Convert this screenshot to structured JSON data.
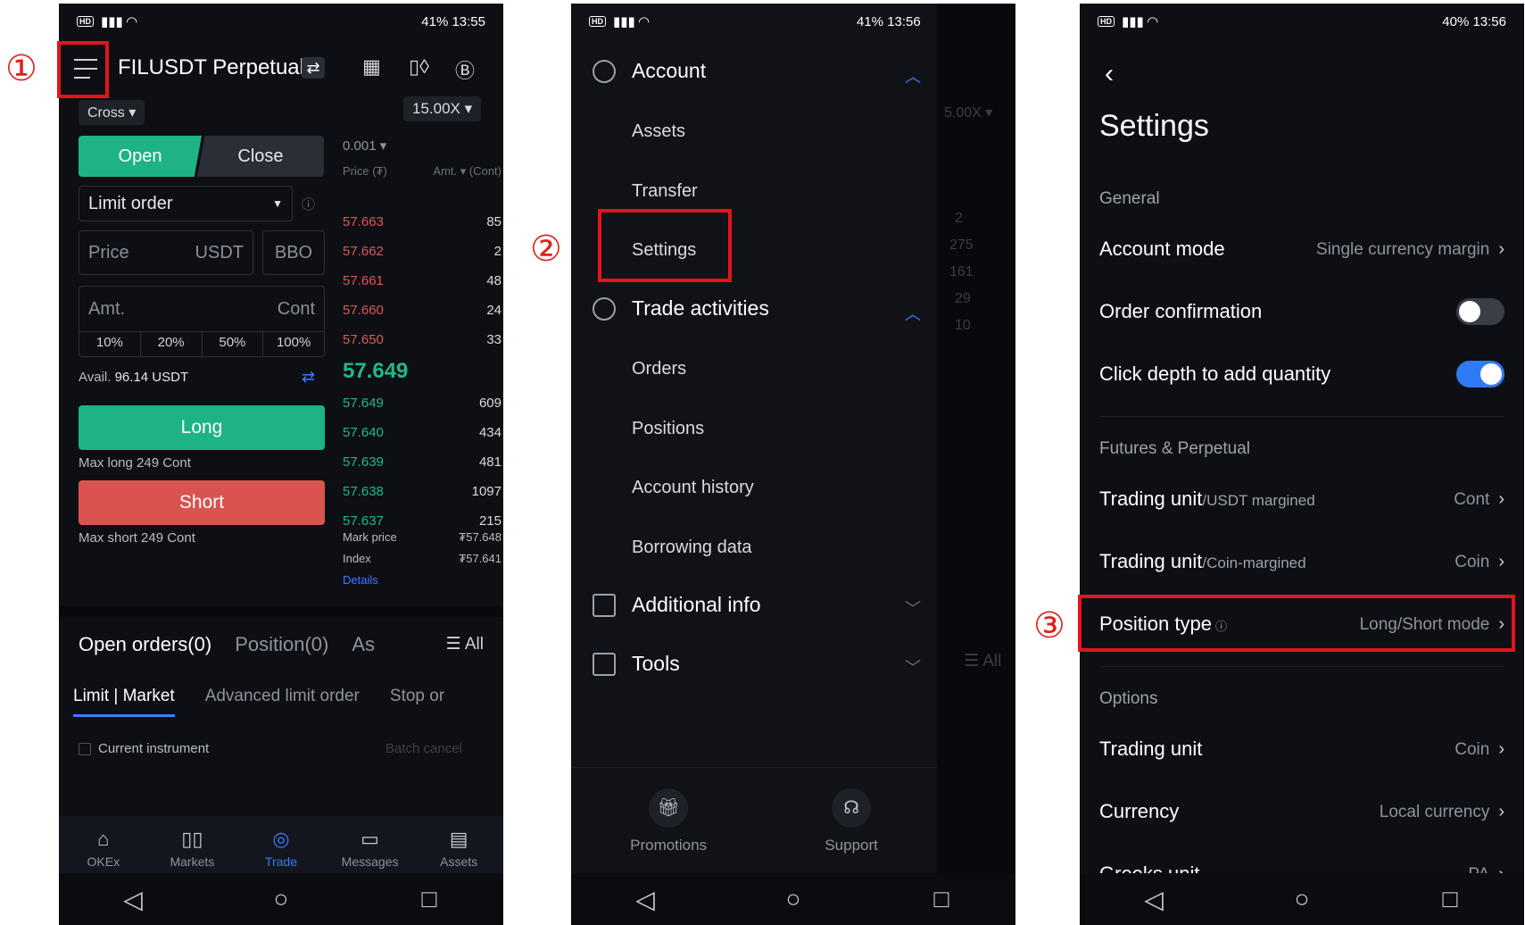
{
  "annotations": [
    "①",
    "②",
    "③"
  ],
  "phone1": {
    "status": {
      "left": "HD",
      "right": "41%  13:55"
    },
    "pair_title": "FILUSDT Perpetual",
    "margin_mode": "Cross ▾",
    "leverage": "15.00X ▾",
    "tick_size": "0.001 ▾",
    "open_tab": "Open",
    "close_tab": "Close",
    "order_type": "Limit order",
    "price_placeholder": "Price",
    "price_unit": "USDT",
    "bbo": "BBO",
    "amt_placeholder": "Amt.",
    "amt_unit": "Cont",
    "percents": [
      "10%",
      "20%",
      "50%",
      "100%"
    ],
    "avail_label": "Avail.",
    "avail_value": "96.14 USDT",
    "long_label": "Long",
    "max_long": "Max long 249 Cont",
    "short_label": "Short",
    "max_short": "Max short 249 Cont",
    "ob_price_header": "Price (₮)",
    "ob_amt_header": "Amt. ▾ (Cont)",
    "asks": [
      {
        "price": "57.663",
        "amt": "85"
      },
      {
        "price": "57.662",
        "amt": "2"
      },
      {
        "price": "57.661",
        "amt": "48"
      },
      {
        "price": "57.660",
        "amt": "24"
      },
      {
        "price": "57.650",
        "amt": "33"
      }
    ],
    "last_price": "57.649",
    "bids": [
      {
        "price": "57.649",
        "amt": "609"
      },
      {
        "price": "57.640",
        "amt": "434"
      },
      {
        "price": "57.639",
        "amt": "481"
      },
      {
        "price": "57.638",
        "amt": "1097"
      },
      {
        "price": "57.637",
        "amt": "215"
      }
    ],
    "mark_label": "Mark price",
    "mark_value": "₮57.648",
    "index_label": "Index",
    "index_value": "₮57.641",
    "details": "Details",
    "tabs": [
      "Open orders(0)",
      "Position(0)",
      "As"
    ],
    "all_label": "☰ All",
    "subtabs": [
      "Limit | Market",
      "Advanced limit order",
      "Stop or"
    ],
    "current_instrument": "Current instrument",
    "batch_cancel": "Batch cancel",
    "tabbar": [
      {
        "icon": "home-icon",
        "label": "OKEx"
      },
      {
        "icon": "candles-icon",
        "label": "Markets"
      },
      {
        "icon": "trade-icon",
        "label": "Trade"
      },
      {
        "icon": "message-icon",
        "label": "Messages"
      },
      {
        "icon": "wallet-icon",
        "label": "Assets"
      }
    ]
  },
  "phone2": {
    "status": {
      "left": "HD",
      "right": "41%  13:56"
    },
    "account": "Account",
    "assets": "Assets",
    "transfer": "Transfer",
    "settings": "Settings",
    "trade_activities": "Trade activities",
    "orders": "Orders",
    "positions": "Positions",
    "account_history": "Account history",
    "borrowing_data": "Borrowing data",
    "additional_info": "Additional info",
    "tools": "Tools",
    "promotions": "Promotions",
    "support": "Support"
  },
  "phone3": {
    "status": {
      "left": "HD",
      "right": "40%  13:56"
    },
    "title": "Settings",
    "general": "General",
    "account_mode_label": "Account mode",
    "account_mode_value": "Single currency margin",
    "order_confirmation": "Order confirmation",
    "click_depth": "Click depth to add quantity",
    "futures_group": "Futures & Perpetual",
    "trading_unit": "Trading unit",
    "usdt_margined": "/USDT margined",
    "usdt_value": "Cont",
    "coin_margined": "/Coin-margined",
    "coin_value": "Coin",
    "position_type_label": "Position type",
    "position_type_value": "Long/Short mode",
    "options_group": "Options",
    "options_trading_unit": "Trading unit",
    "options_trading_value": "Coin",
    "currency_label": "Currency",
    "currency_value": "Local currency",
    "greeks_label": "Greeks unit",
    "greeks_value": "PA"
  },
  "colors": {
    "green": "#1db385",
    "red": "#d9534f",
    "accent": "#3a7bff",
    "annotation": "#e3141b"
  }
}
